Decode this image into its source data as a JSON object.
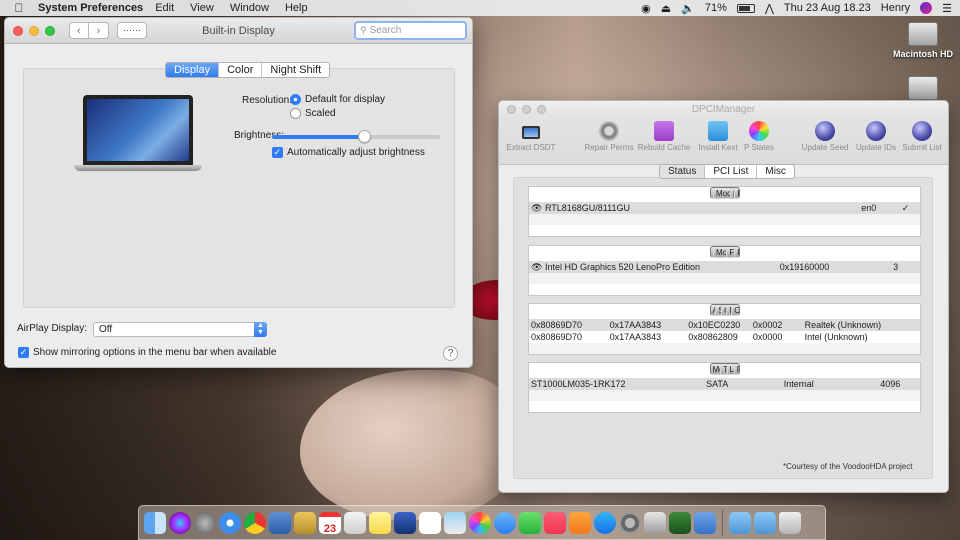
{
  "menubar": {
    "app_name": "System Preferences",
    "menus": [
      "Edit",
      "View",
      "Window",
      "Help"
    ],
    "battery": "71%",
    "clock": "Thu 23 Aug  18.23",
    "user": "Henry"
  },
  "desktop": {
    "hd_label": "Macintosh HD"
  },
  "sysprefs": {
    "title": "Built-in Display",
    "search_placeholder": "Search",
    "tabs": [
      "Display",
      "Color",
      "Night Shift"
    ],
    "resolution_label": "Resolution:",
    "resolution_options": [
      "Default for display",
      "Scaled"
    ],
    "brightness_label": "Brightness:",
    "brightness_level": 0.55,
    "auto_brightness_label": "Automatically adjust brightness",
    "airplay_label": "AirPlay Display:",
    "airplay_value": "Off",
    "mirroring_label": "Show mirroring options in the menu bar when available",
    "help_label": "?"
  },
  "dpci": {
    "title": "DPCIManager",
    "toolbar": [
      "Extract DSDT",
      "Repair Perms",
      "Rebuild Cache",
      "Install Kext",
      "P States",
      "Update Seed",
      "Update IDs",
      "Submit List"
    ],
    "tabs": [
      "Status",
      "PCI List",
      "Misc"
    ],
    "network": {
      "headers": [
        "Model",
        "BSD",
        "Builtin"
      ],
      "row": {
        "model": "RTL8168GU/8111GU",
        "bsd": "en0",
        "builtin": "✓"
      }
    },
    "graphics": {
      "headers": [
        "Model",
        "Framebuffer",
        "Ports"
      ],
      "row": {
        "model": "Intel HD Graphics 520 LenoPro Edition",
        "framebuffer": "0x19160000",
        "ports": "3"
      }
    },
    "audio": {
      "headers": [
        "Audio Device",
        "Sub Device",
        "Codec ID",
        "Revision",
        "Codec Name*"
      ],
      "rows": [
        {
          "device": "0x80869D70",
          "sub": "0x17AA3843",
          "codec": "0x10EC0230",
          "rev": "0x0002",
          "name": "Realtek (Unknown)"
        },
        {
          "device": "0x80869D70",
          "sub": "0x17AA3843",
          "codec": "0x80862809",
          "rev": "0x0000",
          "name": "Intel (Unknown)"
        }
      ]
    },
    "disk": {
      "headers": [
        "Model",
        "Type",
        "Location",
        "Phy Block"
      ],
      "row": {
        "model": "ST1000LM035-1RK172",
        "type": "SATA",
        "location": "Internal",
        "phy": "4096"
      }
    },
    "footer": "*Courtesy of the VoodooHDA project"
  },
  "dock": {
    "apps": [
      "Finder",
      "Siri",
      "Launchpad",
      "Safari",
      "Chrome",
      "Preview",
      "Notes Stickies",
      "Calendar",
      "TextEdit",
      "Notes",
      "Keynote",
      "Reminders",
      "Photos Booth",
      "Photos",
      "Messages",
      "FaceTime",
      "Music",
      "Books",
      "App Store",
      "System Preferences",
      "Script Editor",
      "DPCIManager",
      "Applications",
      "Downloads",
      "Trash"
    ],
    "calendar_day": "23"
  }
}
